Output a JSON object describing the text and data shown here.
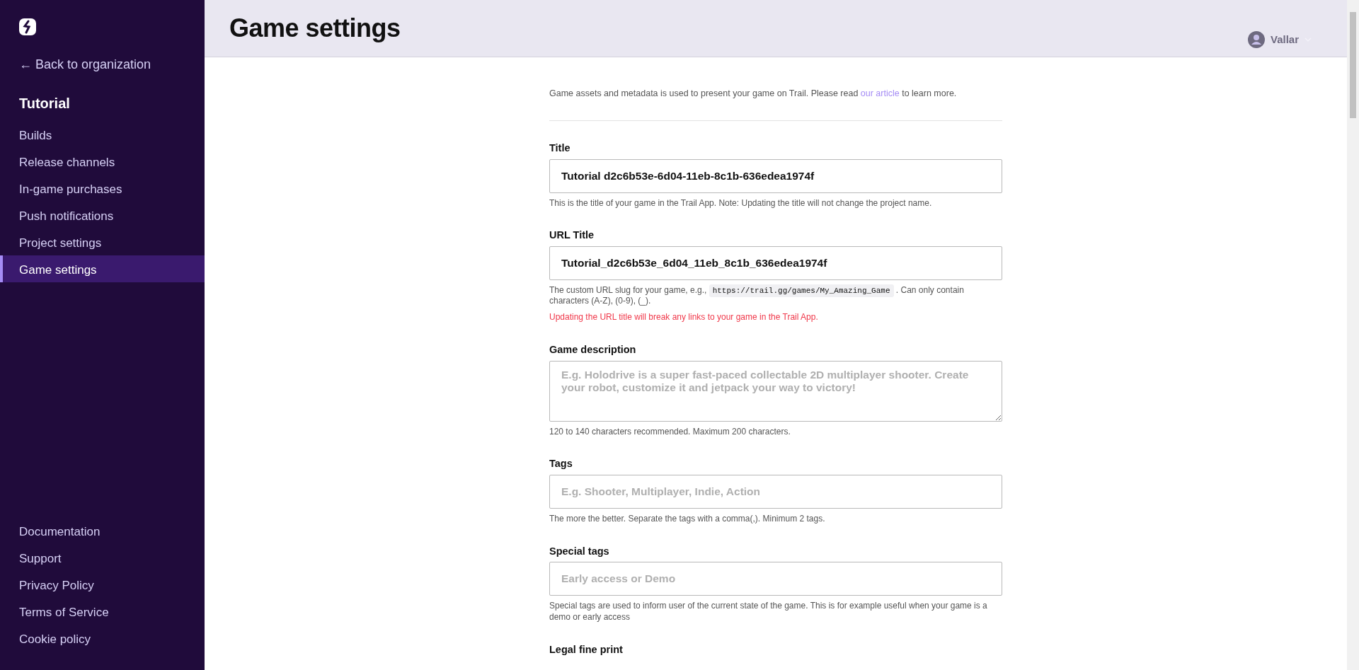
{
  "sidebar": {
    "back_link": "← Back to organization",
    "project": "Tutorial",
    "items": [
      {
        "label": "Builds",
        "selected": false
      },
      {
        "label": "Release channels",
        "selected": false
      },
      {
        "label": "In-game purchases",
        "selected": false
      },
      {
        "label": "Push notifications",
        "selected": false
      },
      {
        "label": "Project settings",
        "selected": false
      },
      {
        "label": "Game settings",
        "selected": true
      }
    ],
    "footer_links": [
      "Documentation",
      "Support",
      "Privacy Policy",
      "Terms of Service",
      "Cookie policy"
    ]
  },
  "header": {
    "title": "Game settings",
    "user": "Vallar"
  },
  "intro": [
    {
      "kind": "text",
      "text": "Game assets and metadata is used to present your game on Trail. Please read "
    },
    {
      "kind": "link",
      "text": "our article"
    },
    {
      "kind": "text",
      "text": " to learn more."
    }
  ],
  "fields": [
    {
      "label": "Title",
      "kind": "input",
      "value": "Tutorial d2c6b53e-6d04-11eb-8c1b-636edea1974f",
      "help": [
        {
          "kind": "text",
          "text": "This is the title of your game in the Trail App. Note: Updating the title will not change the project name."
        }
      ]
    },
    {
      "label": "URL Title",
      "kind": "input",
      "value": "Tutorial_d2c6b53e_6d04_11eb_8c1b_636edea1974f",
      "help": [
        {
          "kind": "text",
          "text": "The custom URL slug for your game, e.g., "
        },
        {
          "kind": "code",
          "text": "https://trail.gg/games/My_Amazing_Game"
        },
        {
          "kind": "text",
          "text": " . Can only contain characters (A-Z), (0-9), (_)."
        }
      ],
      "warning": "Updating the URL title will break any links to your game in the Trail App."
    },
    {
      "label": "Game description",
      "kind": "textarea",
      "placeholder": "E.g. Holodrive is a super fast-paced collectable 2D multiplayer shooter. Create your robot, customize it and jetpack your way to victory!",
      "help": [
        {
          "kind": "text",
          "text": "120 to 140 characters recommended. Maximum 200 characters."
        }
      ]
    },
    {
      "label": "Tags",
      "kind": "input",
      "placeholder": "E.g. Shooter, Multiplayer, Indie, Action",
      "help": [
        {
          "kind": "text",
          "text": "The more the better. Separate the tags with a comma(,). Minimum 2 tags."
        }
      ]
    },
    {
      "label": "Special tags",
      "kind": "input",
      "placeholder": "Early access or Demo",
      "help": [
        {
          "kind": "text",
          "text": "Special tags are used to inform user of the current state of the game. This is for example useful when your game is a demo or early access"
        }
      ]
    },
    {
      "label": "Legal fine print",
      "kind": "label_only"
    }
  ]
}
